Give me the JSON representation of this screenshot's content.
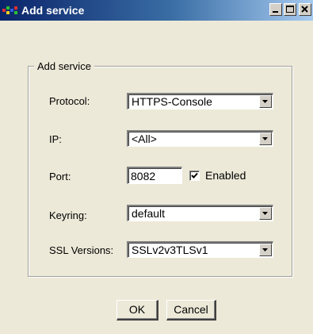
{
  "window": {
    "title": "Add service",
    "icon": "application-icon",
    "controls": [
      "minimize-icon",
      "maximize-icon",
      "close-icon"
    ]
  },
  "group": {
    "legend": "Add service"
  },
  "form": {
    "protocol": {
      "label": "Protocol:",
      "value": "HTTPS-Console"
    },
    "ip": {
      "label": "IP:",
      "value": "<All>"
    },
    "port": {
      "label": "Port:",
      "value": "8082"
    },
    "enabled": {
      "label": "Enabled",
      "checked": true
    },
    "keyring": {
      "label": "Keyring:",
      "value": "default"
    },
    "ssl": {
      "label": "SSL Versions:",
      "value": "SSLv2v3TLSv1"
    }
  },
  "buttons": {
    "ok": "OK",
    "cancel": "Cancel"
  }
}
